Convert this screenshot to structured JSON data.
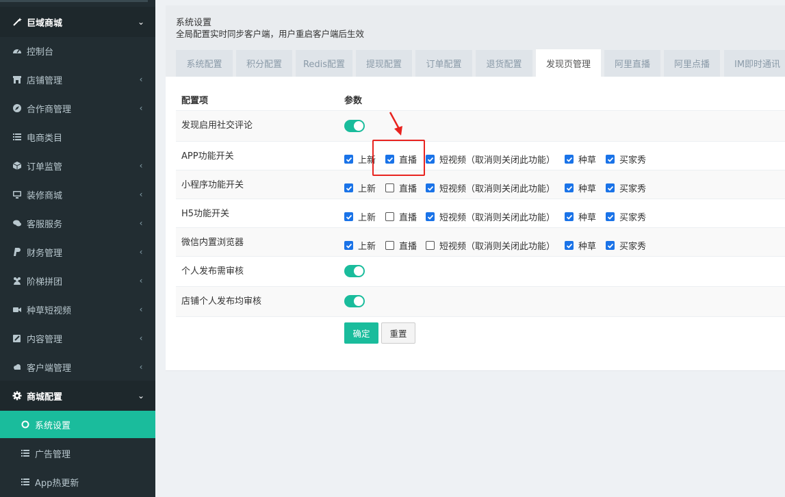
{
  "sidebar": {
    "items": [
      {
        "label": "巨域商城",
        "icon": "magic-wand-icon",
        "arrow": "⌄",
        "head": true
      },
      {
        "label": "控制台",
        "icon": "dashboard-icon",
        "arrow": ""
      },
      {
        "label": "店铺管理",
        "icon": "store-icon",
        "arrow": "‹"
      },
      {
        "label": "合作商管理",
        "icon": "compass-icon",
        "arrow": "‹"
      },
      {
        "label": "电商类目",
        "icon": "list-icon",
        "arrow": ""
      },
      {
        "label": "订单监管",
        "icon": "cube-icon",
        "arrow": "‹"
      },
      {
        "label": "装修商城",
        "icon": "desktop-icon",
        "arrow": "‹"
      },
      {
        "label": "客服服务",
        "icon": "comments-icon",
        "arrow": "‹"
      },
      {
        "label": "财务管理",
        "icon": "paypal-icon",
        "arrow": "‹"
      },
      {
        "label": "阶梯拼团",
        "icon": "users-icon",
        "arrow": "‹"
      },
      {
        "label": "种草短视频",
        "icon": "video-camera-icon",
        "arrow": "‹"
      },
      {
        "label": "内容管理",
        "icon": "edit-icon",
        "arrow": "‹"
      },
      {
        "label": "客户端管理",
        "icon": "cloud-icon",
        "arrow": "‹"
      },
      {
        "label": "商城配置",
        "icon": "gear-icon",
        "arrow": "⌄",
        "head": true
      },
      {
        "label": "系统设置",
        "icon": "circle-icon",
        "arrow": "",
        "active": true
      },
      {
        "label": "广告管理",
        "icon": "list-icon",
        "arrow": "",
        "sub": true
      },
      {
        "label": "App热更新",
        "icon": "list-icon",
        "arrow": "",
        "sub": true
      }
    ]
  },
  "header": {
    "title": "系统设置",
    "subtitle": "全局配置实时同步客户端，用户重启客户端后生效"
  },
  "tabs": [
    {
      "label": "系统配置"
    },
    {
      "label": "积分配置"
    },
    {
      "label": "Redis配置"
    },
    {
      "label": "提现配置"
    },
    {
      "label": "订单配置"
    },
    {
      "label": "退货配置"
    },
    {
      "label": "发现页管理",
      "active": true
    },
    {
      "label": "阿里直播"
    },
    {
      "label": "阿里点播"
    },
    {
      "label": "IM即时通讯"
    }
  ],
  "table": {
    "col_key": "配置项",
    "col_param": "参数",
    "option_labels": [
      "上新",
      "直播",
      "短视频（取消则关闭此功能）",
      "种草",
      "买家秀"
    ],
    "rows": [
      {
        "key": "发现启用社交评论",
        "type": "toggle",
        "on": true
      },
      {
        "key": "APP功能开关",
        "type": "checks",
        "checked": [
          true,
          true,
          true,
          true,
          true
        ]
      },
      {
        "key": "小程序功能开关",
        "type": "checks",
        "checked": [
          true,
          false,
          true,
          true,
          true
        ]
      },
      {
        "key": "H5功能开关",
        "type": "checks",
        "checked": [
          true,
          false,
          true,
          true,
          true
        ]
      },
      {
        "key": "微信内置浏览器",
        "type": "checks",
        "checked": [
          true,
          false,
          false,
          true,
          true
        ]
      },
      {
        "key": "个人发布需审核",
        "type": "toggle",
        "on": true
      },
      {
        "key": "店铺个人发布均审核",
        "type": "toggle",
        "on": true
      }
    ]
  },
  "buttons": {
    "confirm": "确定",
    "reset": "重置"
  },
  "colors": {
    "accent": "#1abc9c",
    "sidebar_bg": "#222d32",
    "checkbox": "#1a73e8",
    "annotation": "#e8231f"
  }
}
